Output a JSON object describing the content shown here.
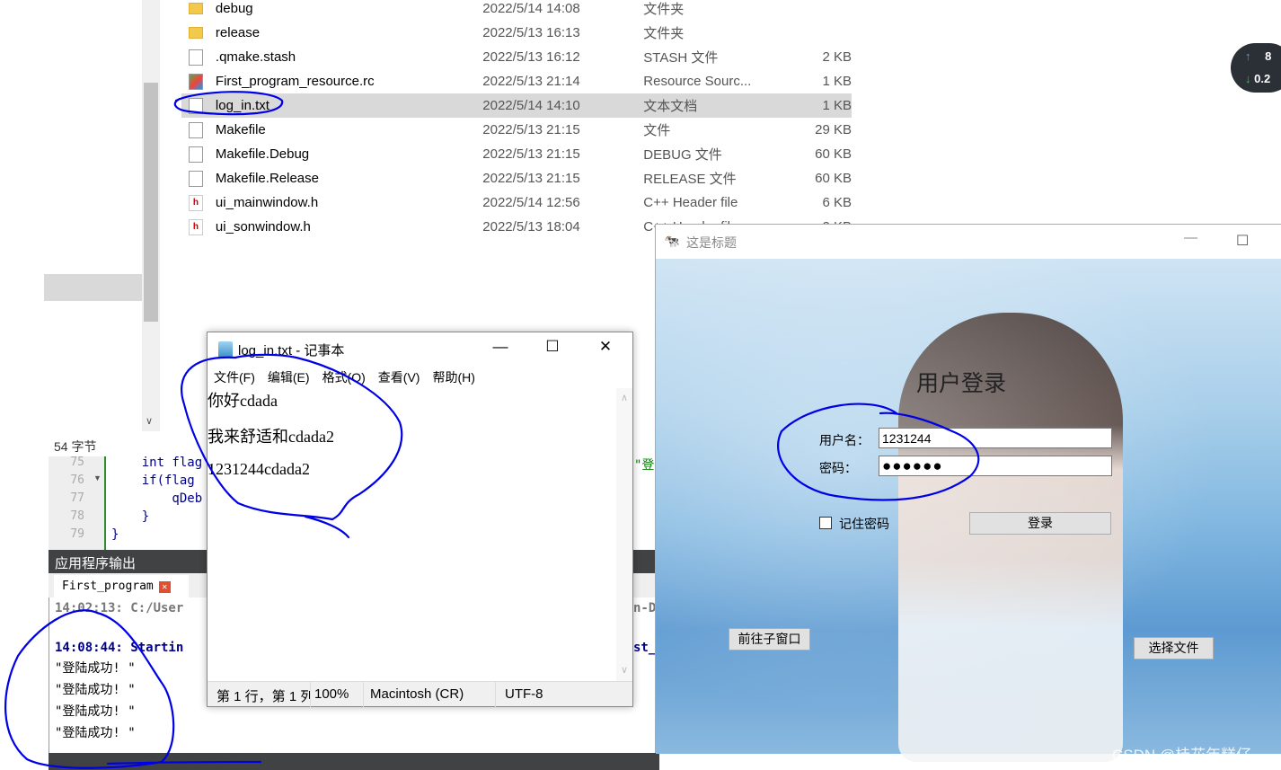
{
  "explorer": {
    "files": [
      {
        "name": "debug",
        "date": "2022/5/14 14:08",
        "type": "文件夹",
        "size": "",
        "icon": "folder-icon"
      },
      {
        "name": "release",
        "date": "2022/5/13 16:13",
        "type": "文件夹",
        "size": "",
        "icon": "folder-icon"
      },
      {
        "name": ".qmake.stash",
        "date": "2022/5/13 16:12",
        "type": "STASH 文件",
        "size": "2 KB",
        "icon": "file-icon"
      },
      {
        "name": "First_program_resource.rc",
        "date": "2022/5/13 21:14",
        "type": "Resource Sourc...",
        "size": "1 KB",
        "icon": "rc-file-icon"
      },
      {
        "name": "log_in.txt",
        "date": "2022/5/14 14:10",
        "type": "文本文档",
        "size": "1 KB",
        "icon": "text-file-icon",
        "selected": true
      },
      {
        "name": "Makefile",
        "date": "2022/5/13 21:15",
        "type": "文件",
        "size": "29 KB",
        "icon": "file-icon"
      },
      {
        "name": "Makefile.Debug",
        "date": "2022/5/13 21:15",
        "type": "DEBUG 文件",
        "size": "60 KB",
        "icon": "file-icon"
      },
      {
        "name": "Makefile.Release",
        "date": "2022/5/13 21:15",
        "type": "RELEASE 文件",
        "size": "60 KB",
        "icon": "file-icon"
      },
      {
        "name": "ui_mainwindow.h",
        "date": "2022/5/14 12:56",
        "type": "C++ Header file",
        "size": "6 KB",
        "icon": "header-file-icon"
      },
      {
        "name": "ui_sonwindow.h",
        "date": "2022/5/13 18:04",
        "type": "C++ Header file",
        "size": "2 KB",
        "icon": "header-file-icon"
      }
    ],
    "status_bytes": "54 字节"
  },
  "editor": {
    "lines": [
      {
        "num": "75",
        "code": "    int flag",
        "fold": false
      },
      {
        "num": "76",
        "code": "    if(flag",
        "fold": true
      },
      {
        "num": "77",
        "code": "        qDeb",
        "fold": false
      },
      {
        "num": "78",
        "code": "    }",
        "fold": false
      },
      {
        "num": "79",
        "code": "}",
        "fold": false
      }
    ],
    "right_fragment": "\"登"
  },
  "output": {
    "panel_title": "应用程序输出",
    "tab_label": "First_program",
    "lines": [
      "14:02:13: C:/User",
      "",
      "14:08:44: Startin",
      "\"登陆成功! \"",
      "\"登陆成功! \"",
      "\"登陆成功! \"",
      "\"登陆成功! \""
    ],
    "right_fragments": [
      "n-D",
      "st_"
    ]
  },
  "notepad": {
    "title": "log_in.txt - 记事本",
    "menu": [
      "文件(F)",
      "编辑(E)",
      "格式(O)",
      "查看(V)",
      "帮助(H)"
    ],
    "content": [
      "你好cdada",
      "我来舒适和cdada2",
      "1231244cdada2"
    ],
    "status": {
      "position": "第 1 行，第 1 列",
      "zoom": "100%",
      "line_ending": "Macintosh (CR)",
      "encoding": "UTF-8"
    }
  },
  "login": {
    "window_title": "这是标题",
    "heading": "用户登录",
    "username_label": "用户名：",
    "username_value": "1231244",
    "password_label": "密码：",
    "password_value": "●●●●●●",
    "remember_label": "记住密码",
    "remember_checked": false,
    "login_button": "登录",
    "child_window_button": "前往子窗口",
    "choose_file_button": "选择文件"
  },
  "netspeed": {
    "upload": "8",
    "download": "0.2",
    "upload_color": "#3ea6ff",
    "download_color": "#2ecc40"
  },
  "watermark": "CSDN @桂花年糕仔",
  "annotation_color": "#0000e6"
}
